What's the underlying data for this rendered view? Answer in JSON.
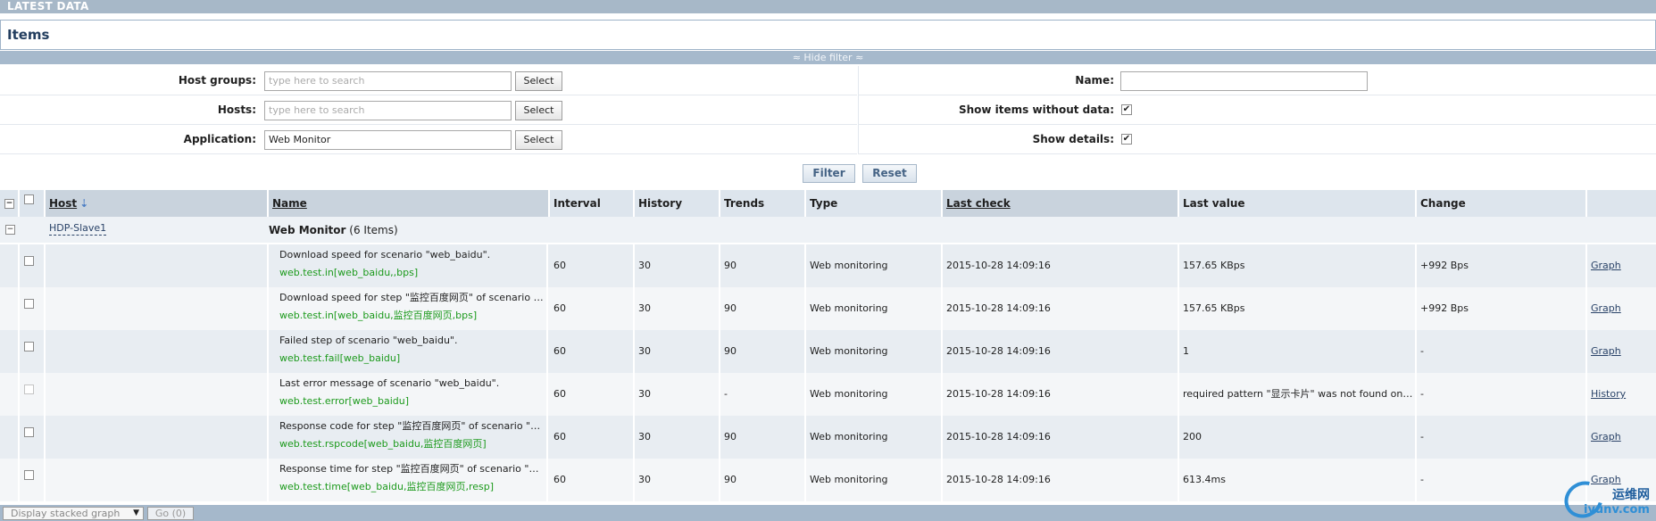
{
  "section": {
    "title": "LATEST DATA"
  },
  "page": {
    "title": "Items"
  },
  "filter_toggle": {
    "label": "Hide filter"
  },
  "filter": {
    "host_groups": {
      "label": "Host groups:",
      "placeholder": "type here to search",
      "button": "Select"
    },
    "hosts": {
      "label": "Hosts:",
      "placeholder": "type here to search",
      "button": "Select"
    },
    "application": {
      "label": "Application:",
      "value": "Web Monitor",
      "button": "Select"
    },
    "name": {
      "label": "Name:",
      "value": ""
    },
    "show_without_data": {
      "label": "Show items without data:",
      "checked": true
    },
    "show_details": {
      "label": "Show details:",
      "checked": true
    },
    "filter_button": "Filter",
    "reset_button": "Reset"
  },
  "table": {
    "columns": {
      "host": "Host",
      "name": "Name",
      "interval": "Interval",
      "history": "History",
      "trends": "Trends",
      "type": "Type",
      "last_check": "Last check",
      "last_value": "Last value",
      "change": "Change"
    },
    "group": {
      "host": "HDP-Slave1",
      "app": "Web Monitor",
      "count": "(6 Items)"
    },
    "rows": [
      {
        "desc": "Download speed for scenario \"web_baidu\".",
        "key": "web.test.in[web_baidu,,bps]",
        "interval": "60",
        "history": "30",
        "trends": "90",
        "type": "Web monitoring",
        "last_check": "2015-10-28 14:09:16",
        "last_value": "157.65 KBps",
        "change": "+992 Bps",
        "action": "Graph"
      },
      {
        "desc": "Download speed for step \"监控百度网页\" of scenario \"web_baidu\".",
        "key": "web.test.in[web_baidu,监控百度网页,bps]",
        "interval": "60",
        "history": "30",
        "trends": "90",
        "type": "Web monitoring",
        "last_check": "2015-10-28 14:09:16",
        "last_value": "157.65 KBps",
        "change": "+992 Bps",
        "action": "Graph"
      },
      {
        "desc": "Failed step of scenario \"web_baidu\".",
        "key": "web.test.fail[web_baidu]",
        "interval": "60",
        "history": "30",
        "trends": "90",
        "type": "Web monitoring",
        "last_check": "2015-10-28 14:09:16",
        "last_value": "1",
        "change": "-",
        "action": "Graph"
      },
      {
        "desc": "Last error message of scenario \"web_baidu\".",
        "key": "web.test.error[web_baidu]",
        "interval": "60",
        "history": "30",
        "trends": "-",
        "type": "Web monitoring",
        "last_check": "2015-10-28 14:09:16",
        "last_value": "required pattern \"显示卡片\" was not found on ...",
        "change": "-",
        "action": "History"
      },
      {
        "desc": "Response code for step \"监控百度网页\" of scenario \"web_baidu\".",
        "key": "web.test.rspcode[web_baidu,监控百度网页]",
        "interval": "60",
        "history": "30",
        "trends": "90",
        "type": "Web monitoring",
        "last_check": "2015-10-28 14:09:16",
        "last_value": "200",
        "change": "-",
        "action": "Graph"
      },
      {
        "desc": "Response time for step \"监控百度网页\" of scenario \"web_baidu\".",
        "key": "web.test.time[web_baidu,监控百度网页,resp]",
        "interval": "60",
        "history": "30",
        "trends": "90",
        "type": "Web monitoring",
        "last_check": "2015-10-28 14:09:16",
        "last_value": "613.4ms",
        "change": "-",
        "action": "Graph"
      }
    ]
  },
  "footer": {
    "action_select": "Display stacked graph",
    "go_button": "Go (0)"
  },
  "watermark": {
    "top": "运维网",
    "bottom": "iyunv.com"
  }
}
